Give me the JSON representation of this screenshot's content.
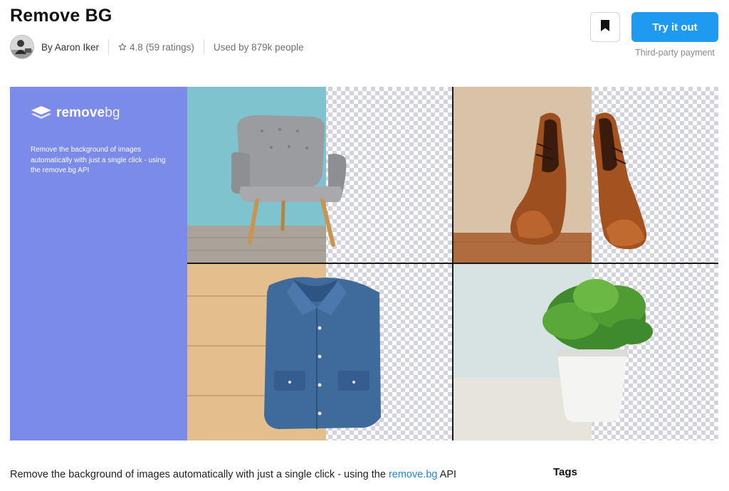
{
  "header": {
    "title": "Remove BG",
    "author": "By Aaron Iker",
    "rating": "4.8 (59 ratings)",
    "usage": "Used by 879k people"
  },
  "actions": {
    "try_label": "Try it out",
    "payment_note": "Third-party payment",
    "bookmark_icon": "bookmark-icon"
  },
  "hero": {
    "brand_main": "remove",
    "brand_suffix": "bg",
    "promo_text": "Remove the background of images automatically with just a single click - using the remove.bg API",
    "background_color": "#7b8bea",
    "tiles": [
      "chair",
      "shoes",
      "shirt",
      "plant"
    ]
  },
  "description": {
    "text_before": "Remove the background of images automatically with just a single click - using the ",
    "link_text": "remove.bg",
    "text_after": " API"
  },
  "sidebar": {
    "tags_heading": "Tags"
  },
  "colors": {
    "accent": "#1e9bf0",
    "link": "#1e88e5"
  }
}
